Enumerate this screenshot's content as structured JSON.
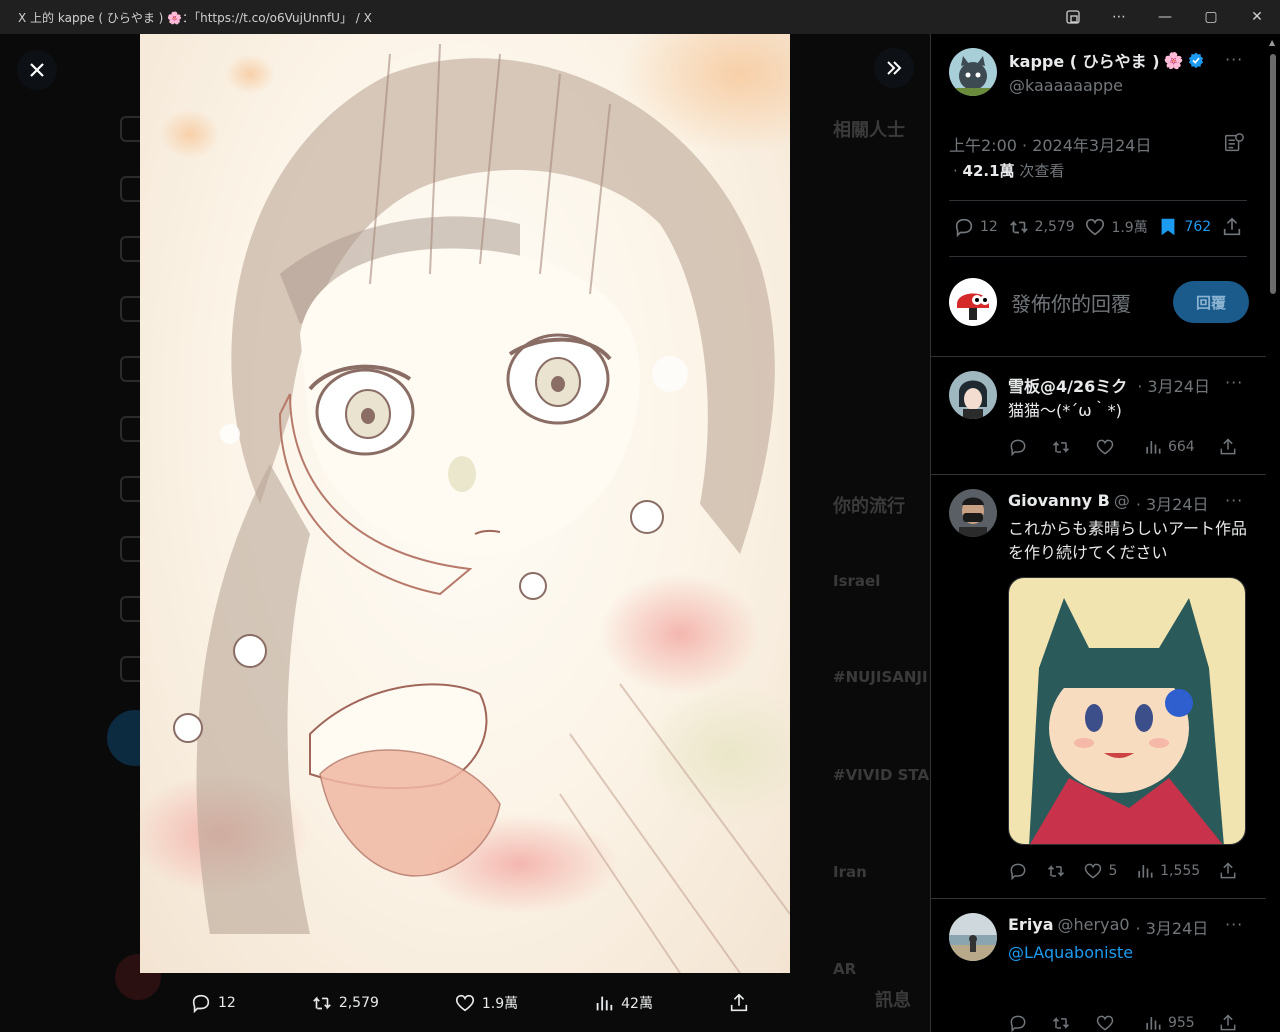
{
  "window": {
    "title": "X 上的 kappe ( ひらやま ) 🌸：「https://t.co/o6VujUnnfU」 / X",
    "buttons": [
      "screen-icon",
      "more-icon",
      "minimize-icon",
      "maximize-icon",
      "close-icon"
    ]
  },
  "media_actions": {
    "replies": "12",
    "retweets": "2,579",
    "likes": "1.9萬",
    "views": "42萬"
  },
  "backdrop": {
    "related_heading": "相關人士",
    "trending_heading": "你的流行",
    "trends": [
      "Israel",
      "#NUJISANJI",
      "#VIVID STA",
      "Iran",
      "AR"
    ],
    "messages": "訊息"
  },
  "tweet": {
    "author_name": "kappe ( ひらやま )",
    "author_emoji": "🌸",
    "author_handle": "@kaaaaaappe",
    "time": "上午2:00 · 2024年3月24日",
    "views_count": "42.1萬",
    "views_label": "次查看",
    "replies": "12",
    "retweets": "2,579",
    "likes": "1.9萬",
    "bookmarks": "762",
    "reply_placeholder": "發佈你的回覆",
    "reply_button": "回覆"
  },
  "replies": [
    {
      "name": "雪板@4/26ミク",
      "handle": "",
      "time": "· 3月24日",
      "text": "猫猫～(*´ω｀*)",
      "link": false,
      "likes": "",
      "views": "664"
    },
    {
      "name": "Giovanny B",
      "handle": "@",
      "time": "· 3月24日",
      "text": "これからも素晴らしいアート作品を作り続けてください",
      "link": false,
      "likes": "5",
      "views": "1,555"
    },
    {
      "name": "Eriya",
      "handle": "@herya0",
      "time": "· 3月24日",
      "text": "@LAquaboniste",
      "link": true,
      "likes": "",
      "views": "955"
    }
  ],
  "colors": {
    "accent": "#1d9bf0",
    "muted": "#71767b",
    "background": "#000000",
    "border": "#2f3336"
  }
}
